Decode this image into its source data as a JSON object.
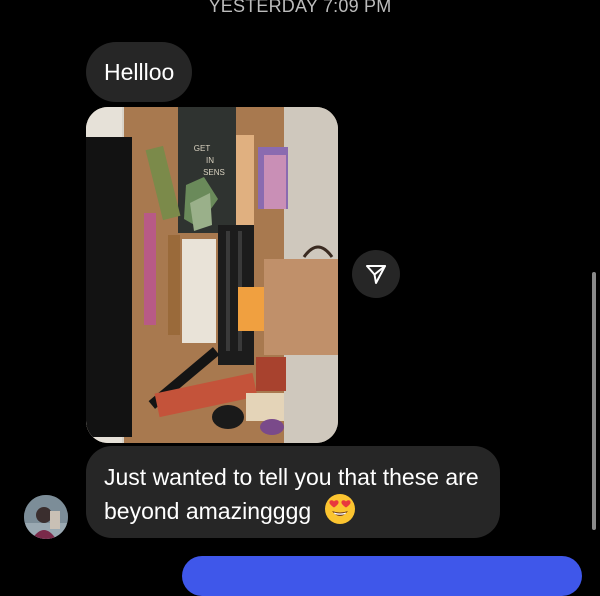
{
  "thread": {
    "timestamp": "YESTERDAY 7:09 PM",
    "messages": [
      {
        "text": "Hellloo"
      },
      {
        "text": "Just wanted to tell you that these are beyond amazingggg"
      }
    ],
    "photo_texts": [
      "GET",
      "IN",
      "SENS"
    ]
  },
  "icons": {
    "share": "send-paper-plane-icon",
    "emoji": "heart-eyes-emoji-icon",
    "avatar": "sender-avatar"
  },
  "colors": {
    "background": "#000000",
    "incoming_bubble": "#262626",
    "outgoing_bubble": "#3f57ea",
    "timestamp": "#bcbcbc"
  }
}
